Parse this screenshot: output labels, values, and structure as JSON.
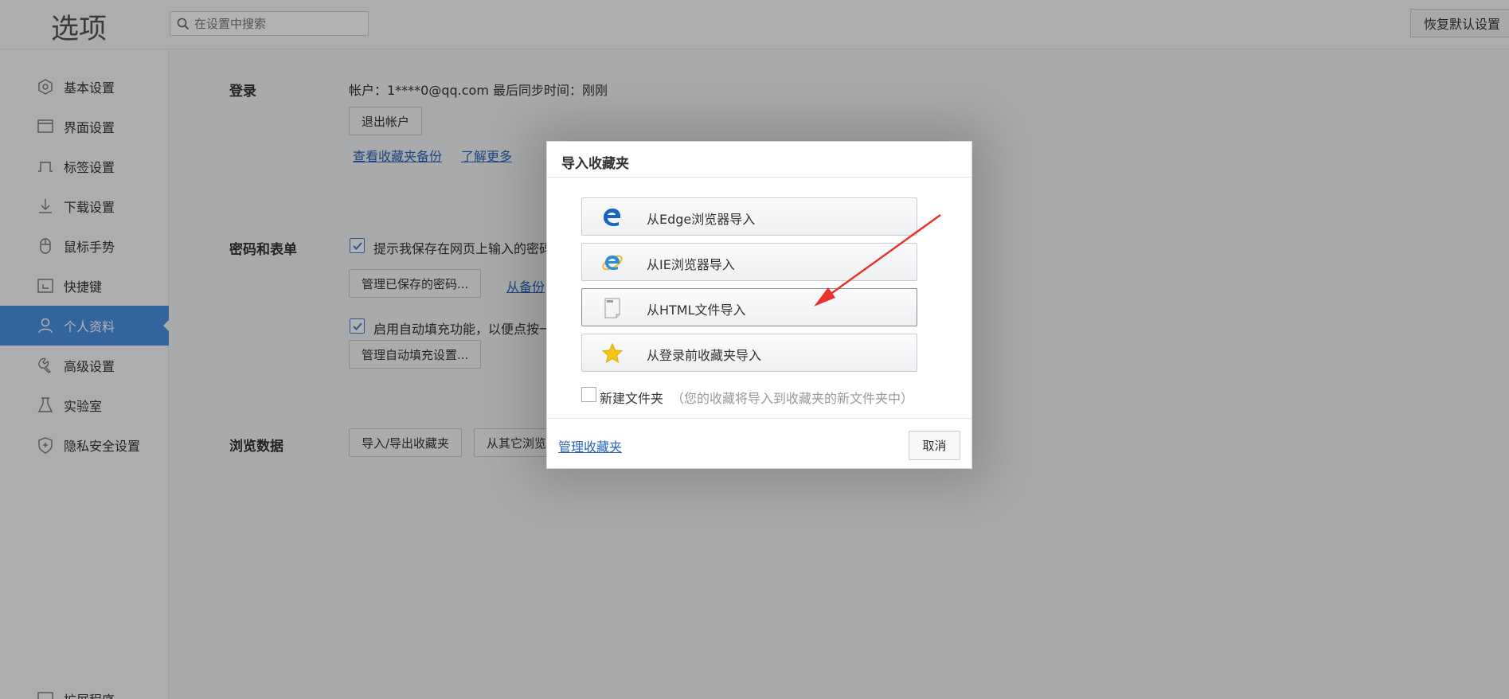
{
  "header": {
    "title": "选项",
    "search_placeholder": "在设置中搜索",
    "restore_label": "恢复默认设置"
  },
  "sidebar": {
    "items": [
      {
        "label": "基本设置",
        "icon": "gear-icon"
      },
      {
        "label": "界面设置",
        "icon": "window-icon"
      },
      {
        "label": "标签设置",
        "icon": "tab-icon"
      },
      {
        "label": "下载设置",
        "icon": "download-icon"
      },
      {
        "label": "鼠标手势",
        "icon": "mouse-icon"
      },
      {
        "label": "快捷键",
        "icon": "keyboard-icon"
      },
      {
        "label": "个人资料",
        "icon": "user-icon",
        "active": true
      },
      {
        "label": "高级设置",
        "icon": "wrench-icon"
      },
      {
        "label": "实验室",
        "icon": "flask-icon"
      },
      {
        "label": "隐私安全设置",
        "icon": "shield-icon"
      }
    ],
    "bottom_partial_label": "扩展程序"
  },
  "login": {
    "title": "登录",
    "account_text": "帐户：1****0@qq.com  最后同步时间：刚刚",
    "logout_button": "退出帐户",
    "view_backup_link": "查看收藏夹备份",
    "learn_more_link": "了解更多"
  },
  "password": {
    "title": "密码和表单",
    "save_password_label": "提示我保存在网页上输入的密码",
    "save_password_checked": true,
    "manage_passwords_button": "管理已保存的密码...",
    "from_backup_link": "从备份",
    "autofill_label": "启用自动填充功能，以便点按一次",
    "autofill_checked": true,
    "manage_autofill_button": "管理自动填充设置..."
  },
  "browsing": {
    "title": "浏览数据",
    "import_export_button": "导入/导出收藏夹",
    "other_browser_button": "从其它浏览器"
  },
  "dialog": {
    "title": "导入收藏夹",
    "options": [
      {
        "label": "从Edge浏览器导入",
        "icon": "edge-icon"
      },
      {
        "label": "从IE浏览器导入",
        "icon": "ie-icon"
      },
      {
        "label": "从HTML文件导入",
        "icon": "html-file-icon"
      },
      {
        "label": "从登录前收藏夹导入",
        "icon": "star-icon"
      }
    ],
    "new_folder_label": "新建文件夹",
    "new_folder_checked": false,
    "new_folder_hint": "（您的收藏将导入到收藏夹的新文件夹中）",
    "manage_link": "管理收藏夹",
    "cancel_button": "取消"
  },
  "colors": {
    "accent": "#4a90e2",
    "link": "#2a63b8",
    "annotation_arrow": "#e8322b"
  }
}
